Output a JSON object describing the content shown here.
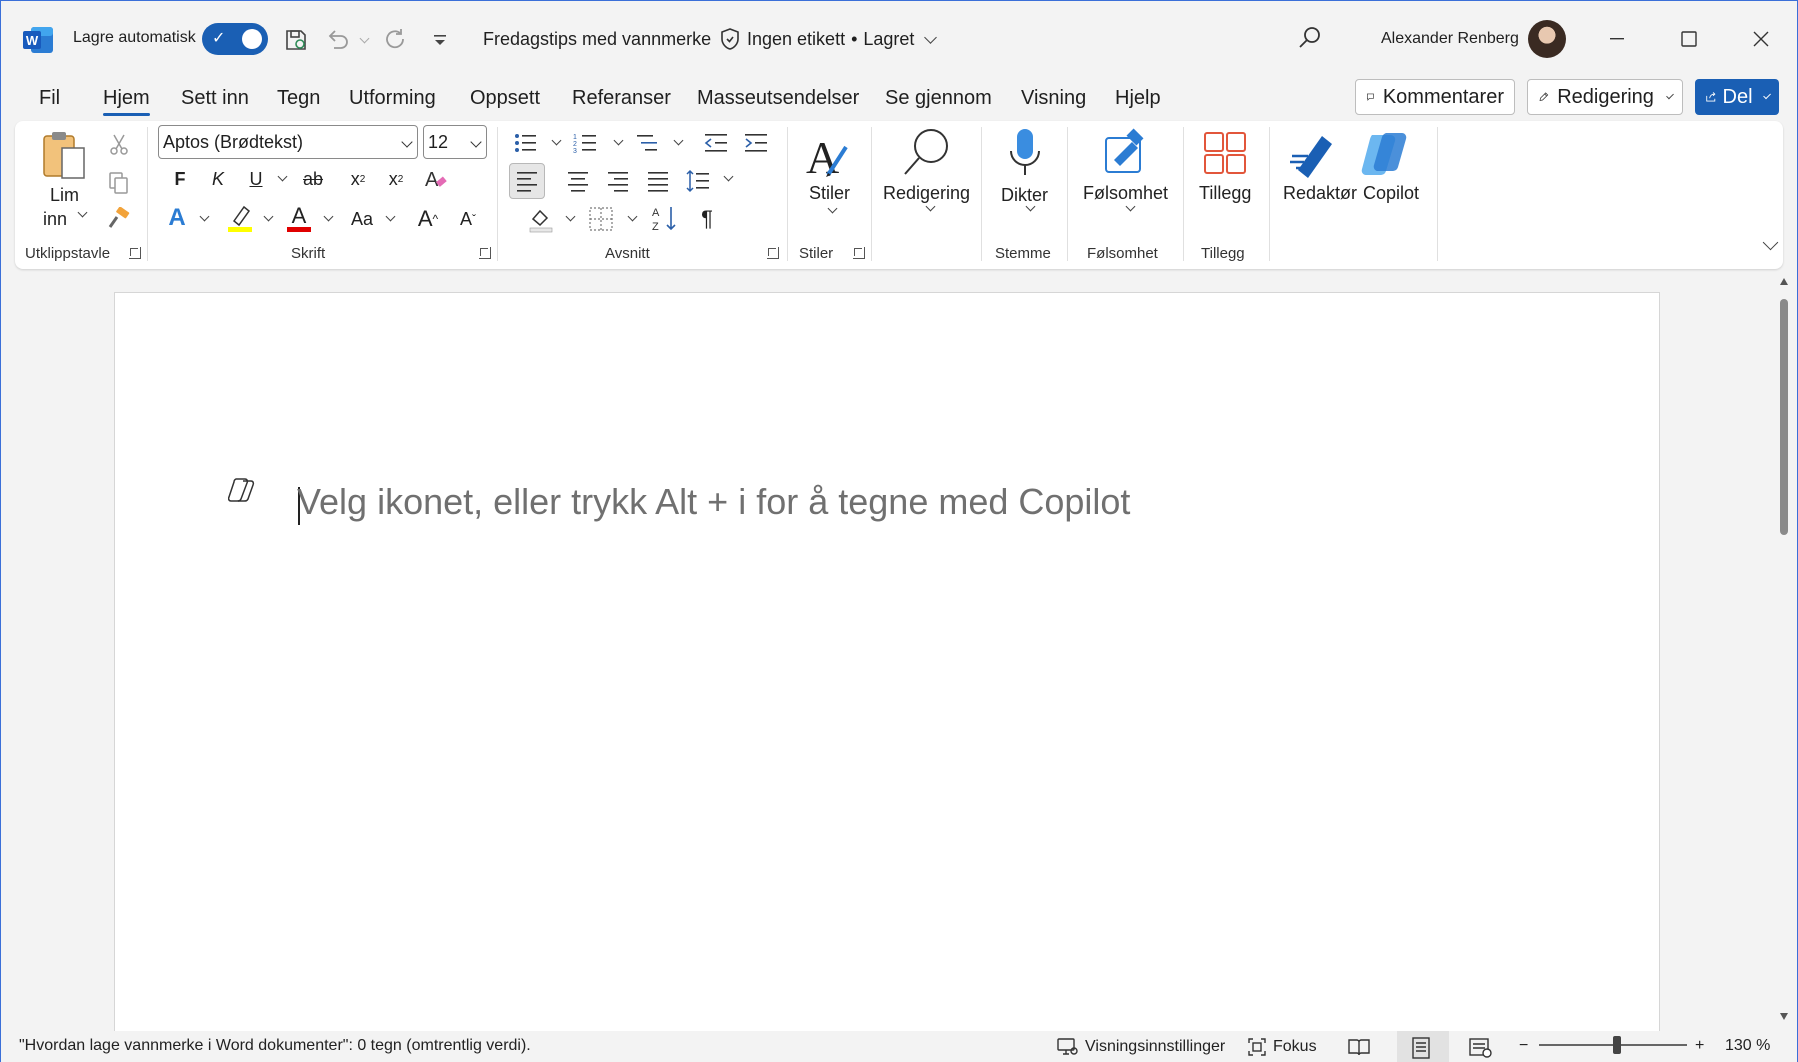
{
  "titlebar": {
    "autosave_label": "Lagre automatisk",
    "autosave_on": true,
    "document_title": "Fredagstips med vannmerke",
    "sensitivity_label": "Ingen etikett",
    "save_state": "Lagret",
    "username": "Alexander Renberg"
  },
  "tabs": [
    {
      "label": "Fil"
    },
    {
      "label": "Hjem",
      "active": true
    },
    {
      "label": "Sett inn"
    },
    {
      "label": "Tegn"
    },
    {
      "label": "Utforming"
    },
    {
      "label": "Oppsett"
    },
    {
      "label": "Referanser"
    },
    {
      "label": "Masseutsendelser"
    },
    {
      "label": "Se gjennom"
    },
    {
      "label": "Visning"
    },
    {
      "label": "Hjelp"
    }
  ],
  "actions": {
    "comments_label": "Kommentarer",
    "editing_label": "Redigering",
    "share_label": "Del"
  },
  "ribbon": {
    "clipboard": {
      "paste_label_1": "Lim",
      "paste_label_2": "inn",
      "group_label": "Utklippstavle"
    },
    "font": {
      "font_name": "Aptos (Brødtekst)",
      "font_size": "12",
      "bold": "F",
      "italic": "K",
      "underline": "U",
      "strike": "ab",
      "subscript": "x",
      "superscript": "x",
      "change_case": "Aa",
      "grow": "A",
      "shrink": "A",
      "text_effects": "A",
      "font_color": "A",
      "group_label": "Skrift"
    },
    "paragraph": {
      "group_label": "Avsnitt",
      "pilcrow": "¶"
    },
    "styles": {
      "label": "Stiler",
      "group_label": "Stiler"
    },
    "editing": {
      "label": "Redigering"
    },
    "voice": {
      "label": "Dikter",
      "group_label": "Stemme"
    },
    "sensitivity": {
      "label": "Følsomhet",
      "group_label": "Følsomhet"
    },
    "addins": {
      "label": "Tillegg",
      "group_label": "Tillegg"
    },
    "editor": {
      "label": "Redaktør"
    },
    "copilot": {
      "label": "Copilot"
    }
  },
  "document": {
    "placeholder": "Velg ikonet, eller trykk Alt + i for å tegne med Copilot"
  },
  "statusbar": {
    "word_count": "\"Hvordan lage vannmerke i Word dokumenter\": 0 tegn (omtrentlig verdi).",
    "display_settings": "Visningsinnstillinger",
    "focus": "Fokus",
    "zoom_minus": "−",
    "zoom_plus": "+",
    "zoom_level": "130 %",
    "zoom_fraction": 0.5
  },
  "colors": {
    "accent": "#1a5fb4",
    "highlight": "#ffff00",
    "font_color": "#e00000"
  }
}
